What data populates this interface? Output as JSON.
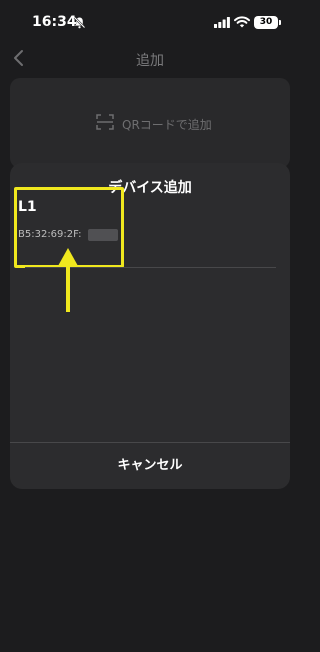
{
  "status_bar": {
    "time": "16:34",
    "battery": "30",
    "icons": [
      "bell-slash-icon",
      "signal-icon",
      "wifi-icon",
      "battery-icon"
    ]
  },
  "background": {
    "nav_title": "追加",
    "back_icon": "chevron-left-icon",
    "qr_option_label": "QRコードで追加",
    "qr_icon": "qr-scan-icon"
  },
  "dialog": {
    "title": "デバイス追加",
    "devices": [
      {
        "name": "L1",
        "mac": "B5:32:69:2F:"
      }
    ],
    "cancel_label": "キャンセル"
  },
  "annotation": {
    "highlight_color": "#f0e81e",
    "arrow_icon": "arrow-up-icon"
  }
}
